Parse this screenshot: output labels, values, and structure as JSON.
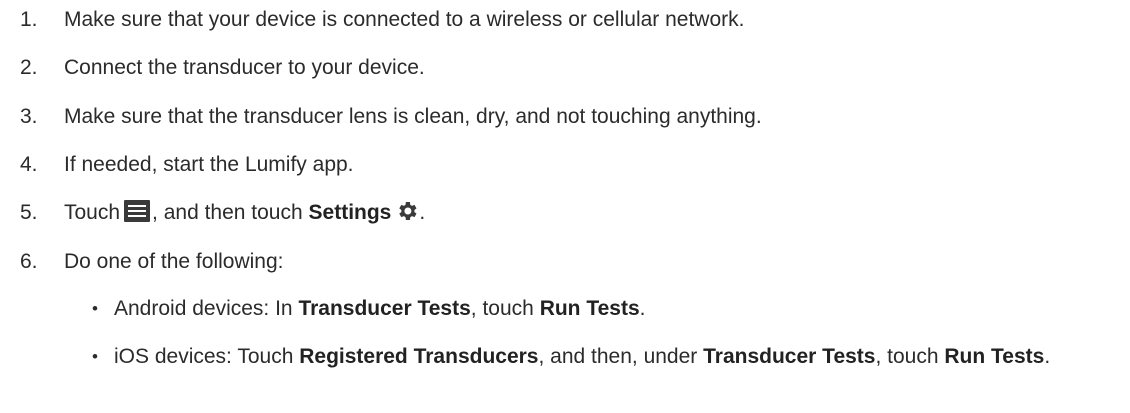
{
  "steps": [
    {
      "number": "1.",
      "text": "Make sure that your device is connected to a wireless or cellular network."
    },
    {
      "number": "2.",
      "text": "Connect the transducer to your device."
    },
    {
      "number": "3.",
      "text": "Make sure that the transducer lens is clean, dry, and not touching anything."
    },
    {
      "number": "4.",
      "text": "If needed, start the Lumify app."
    },
    {
      "number": "5.",
      "before": "Touch",
      "after": ", and then touch",
      "bold": "Settings",
      "end": ".",
      "icons": [
        "menu-icon",
        "gear-icon"
      ]
    },
    {
      "number": "6.",
      "text": "Do one of the following:"
    }
  ],
  "sub_items": [
    {
      "bullet": "•",
      "parts": [
        "Android devices: In ",
        "Transducer Tests",
        ", touch ",
        "Run Tests",
        "."
      ]
    },
    {
      "bullet": "•",
      "parts": [
        "iOS devices: Touch ",
        "Registered Transducers",
        ", and then, under ",
        "Transducer Tests",
        ", touch ",
        "Run Tests",
        "."
      ]
    }
  ]
}
